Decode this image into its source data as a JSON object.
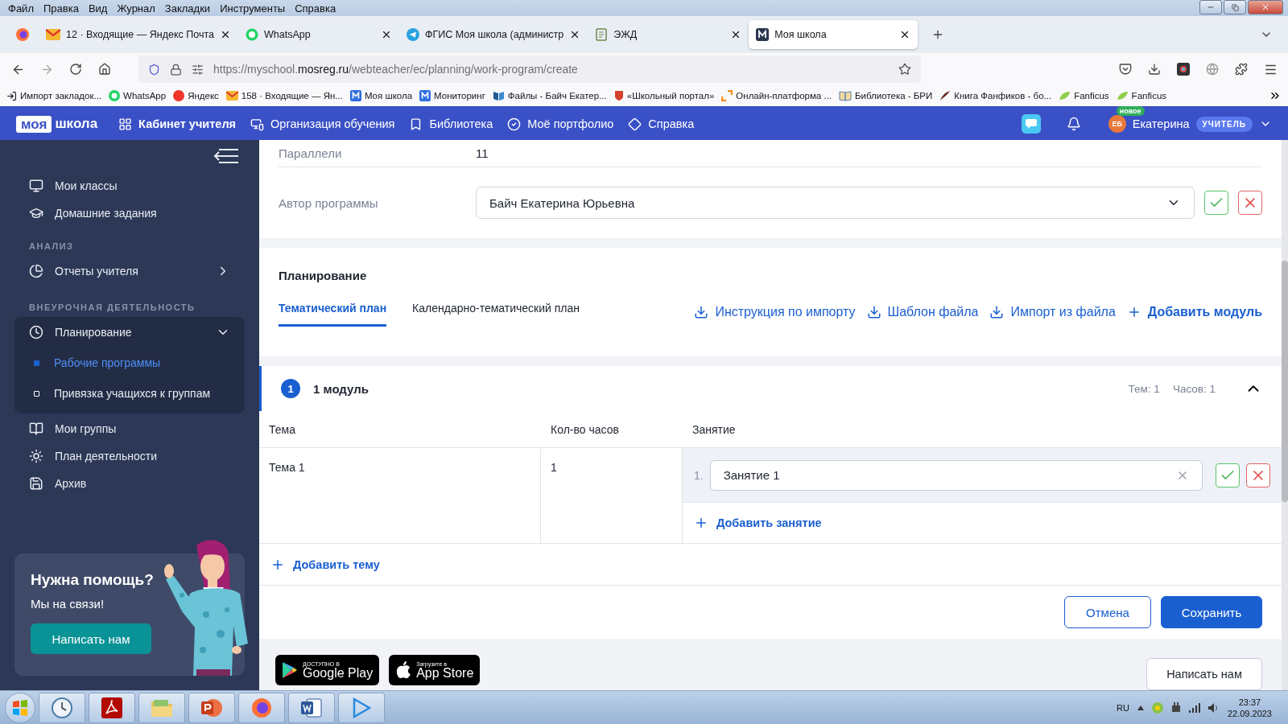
{
  "menu_bar": [
    "Файл",
    "Правка",
    "Вид",
    "Журнал",
    "Закладки",
    "Инструменты",
    "Справка"
  ],
  "browser_tabs": [
    {
      "title": "12 · Входящие — Яндекс Почта",
      "selected": false
    },
    {
      "title": "WhatsApp",
      "selected": false
    },
    {
      "title": "ФГИС Моя школа (администр",
      "selected": false
    },
    {
      "title": "ЭЖД",
      "selected": false
    },
    {
      "title": "Моя школа",
      "selected": true
    }
  ],
  "address_bar": {
    "url_start": "https://myschool.",
    "url_host": "mosreg.ru",
    "url_path": "/webteacher/ec/planning/work-program/create"
  },
  "bookmarks": [
    "Импорт закладок...",
    "WhatsApp",
    "Яндекс",
    "158 · Входящие — Ян...",
    "Моя школа",
    "Мониторинг",
    "Файлы - Байч Екатер...",
    "«Школьный портал»",
    "Онлайн-платформа ...",
    "Библиотека - БРИ",
    "Книга Фанфиков - бо...",
    "Fanficus",
    "Fanficus"
  ],
  "app_header": {
    "logo": [
      "моя",
      "школа"
    ],
    "nav": [
      {
        "label": "Кабинет учителя",
        "selected": true
      },
      {
        "label": "Организация обучения",
        "selected": false
      },
      {
        "label": "Библиотека",
        "selected": false
      },
      {
        "label": "Моё портфолио",
        "selected": false
      },
      {
        "label": "Справка",
        "selected": false
      }
    ],
    "user": {
      "avatar": "ЕБ",
      "new_badge": "новое",
      "name": "Екатерина",
      "role": "УЧИТЕЛЬ"
    }
  },
  "sidebar": {
    "sections": [
      {
        "items": [
          {
            "label": "Мои классы",
            "kind": "link"
          },
          {
            "label": "Домашние задания",
            "kind": "link"
          }
        ]
      },
      {
        "heading": "АНАЛИЗ",
        "items": [
          {
            "label": "Отчеты учителя",
            "kind": "group",
            "expanded": false
          }
        ]
      },
      {
        "heading": "ВНЕУРОЧНАЯ ДЕЯТЕЛЬНОСТЬ",
        "items": [
          {
            "label": "Планирование",
            "kind": "group",
            "expanded": true,
            "children": [
              {
                "label": "Рабочие программы",
                "selected": true
              },
              {
                "label": "Привязка учащихся к группам",
                "selected": false
              }
            ]
          },
          {
            "label": "Мои группы",
            "kind": "link"
          },
          {
            "label": "План деятельности",
            "kind": "link"
          },
          {
            "label": "Архив",
            "kind": "link"
          }
        ]
      }
    ],
    "help": {
      "title": "Нужна помощь?",
      "text": "Мы на связи!",
      "button": "Написать нам"
    }
  },
  "program_fields": [
    {
      "label": "Параллели",
      "value": "11",
      "kind": "text"
    },
    {
      "label": "Автор программы",
      "value": "Байч Екатерина Юрьевна",
      "kind": "select"
    }
  ],
  "planning": {
    "title": "Планирование",
    "tabs": [
      {
        "label": "Тематический план",
        "selected": true
      },
      {
        "label": "Календарно-тематический план",
        "selected": false
      }
    ],
    "actions": [
      {
        "label": "Инструкция по импорту",
        "kind": "download"
      },
      {
        "label": "Шаблон файла",
        "kind": "download"
      },
      {
        "label": "Импорт из файла",
        "kind": "download"
      },
      {
        "label": "Добавить модуль",
        "kind": "add"
      }
    ]
  },
  "module": {
    "number": "1",
    "title": "1 модуль",
    "stats": [
      "Тем: 1",
      "Часов: 1"
    ],
    "expanded": true,
    "columns": [
      "Тема",
      "Кол-во часов",
      "Занятие"
    ],
    "rows": [
      {
        "topic": "Тема 1",
        "hours": "1",
        "lessons": [
          {
            "number": "1.",
            "value": "Занятие 1"
          }
        ],
        "add_lesson": "Добавить занятие"
      }
    ],
    "add_topic": "Добавить тему"
  },
  "form_buttons": [
    {
      "label": "Отмена",
      "kind": "secondary"
    },
    {
      "label": "Сохранить",
      "kind": "primary"
    }
  ],
  "footer": {
    "stores": [
      {
        "small": "ДОСТУПНО В",
        "big": "Google Play"
      },
      {
        "small": "Загрузите в",
        "big": "App Store"
      }
    ],
    "contact": "Написать нам"
  },
  "taskbar": {
    "language": "RU",
    "time": "23:37",
    "date": "22.09.2023"
  }
}
